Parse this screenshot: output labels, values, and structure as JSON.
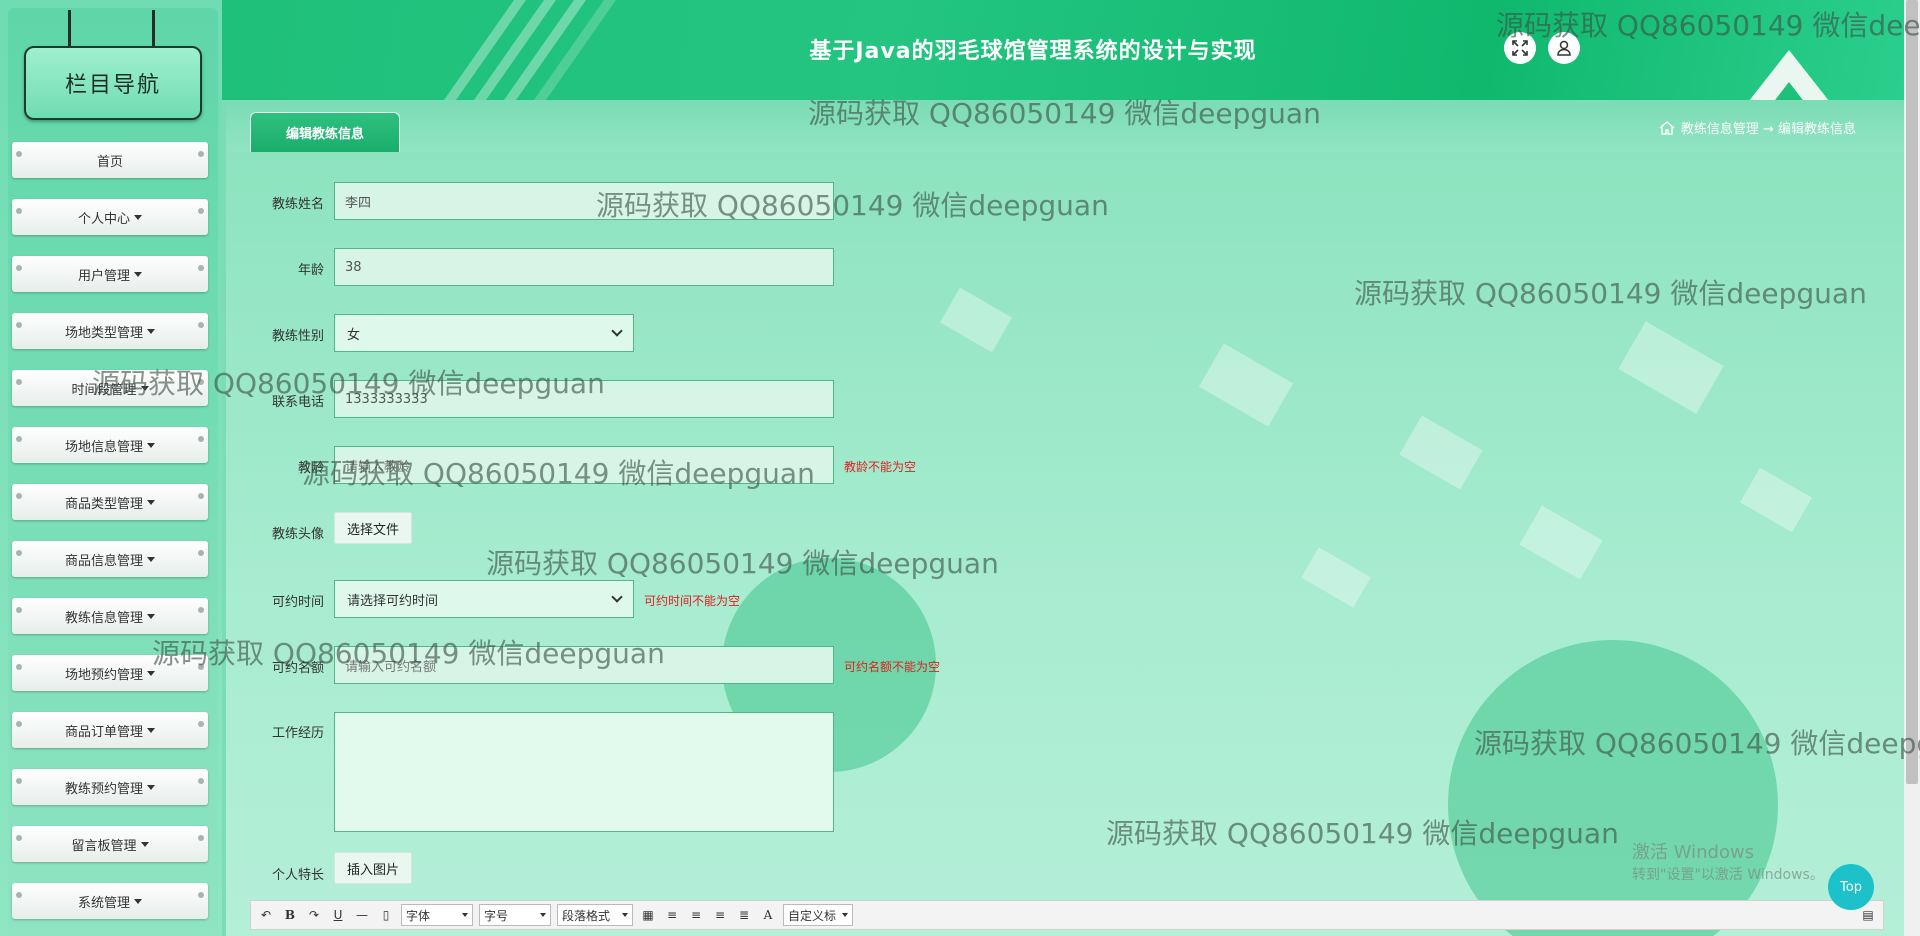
{
  "header": {
    "site_title": "基于Java的羽毛球馆管理系统的设计与实现",
    "fullscreen_icon": "expand-icon",
    "user_icon": "user-icon"
  },
  "sidebar": {
    "title": "栏目导航",
    "items": [
      {
        "label": "首页",
        "has_caret": false
      },
      {
        "label": "个人中心",
        "has_caret": true
      },
      {
        "label": "用户管理",
        "has_caret": true
      },
      {
        "label": "场地类型管理",
        "has_caret": true
      },
      {
        "label": "时间段管理",
        "has_caret": true
      },
      {
        "label": "场地信息管理",
        "has_caret": true
      },
      {
        "label": "商品类型管理",
        "has_caret": true
      },
      {
        "label": "商品信息管理",
        "has_caret": true
      },
      {
        "label": "教练信息管理",
        "has_caret": true
      },
      {
        "label": "场地预约管理",
        "has_caret": true
      },
      {
        "label": "商品订单管理",
        "has_caret": true
      },
      {
        "label": "教练预约管理",
        "has_caret": true
      },
      {
        "label": "留言板管理",
        "has_caret": true
      },
      {
        "label": "系统管理",
        "has_caret": true
      }
    ]
  },
  "tab": {
    "label": "编辑教练信息"
  },
  "breadcrumb": {
    "text": "教练信息管理 → 编辑教练信息"
  },
  "form": {
    "name": {
      "label": "教练姓名",
      "value": "李四"
    },
    "age": {
      "label": "年龄",
      "value": "38"
    },
    "gender": {
      "label": "教练性别",
      "value": "女"
    },
    "phone": {
      "label": "联系电话",
      "value": "1333333333"
    },
    "years": {
      "label": "教龄",
      "placeholder": "请输入教龄",
      "error": "教龄不能为空"
    },
    "avatar": {
      "label": "教练头像",
      "button": "选择文件"
    },
    "available_time": {
      "label": "可约时间",
      "placeholder": "请选择可约时间",
      "error": "可约时间不能为空"
    },
    "quota": {
      "label": "可约名额",
      "placeholder": "请输入可约名额",
      "error": "可约名额不能为空"
    },
    "experience": {
      "label": "工作经历"
    },
    "specialty": {
      "label": "个人特长",
      "button": "插入图片"
    }
  },
  "editor_toolbar": {
    "font_label": "字体",
    "size_label": "字号",
    "paragraph_label": "段落格式",
    "custom_title_label": "自定义标题"
  },
  "watermark": {
    "text": "源码获取 QQ86050149 微信deepguan"
  },
  "windows_activation": {
    "title": "激活 Windows",
    "subtitle": "转到\"设置\"以激活 Windows。"
  },
  "top_button": {
    "label": "Top"
  }
}
